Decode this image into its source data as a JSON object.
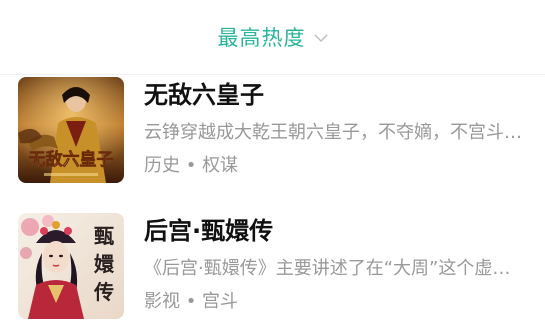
{
  "sort": {
    "label": "最高热度",
    "icon": "chevron-down-icon",
    "accent_color": "#2bb59a"
  },
  "books": [
    {
      "title": "无敌六皇子",
      "description": "云铮穿越成大乾王朝六皇子，不夺嫡，不宫斗…",
      "tags": "历史 • 权谋",
      "cover_text": "无敌六皇子"
    },
    {
      "title": "后宫·甄嬛传",
      "description": "《后宫·甄嬛传》主要讲述了在“大周”这个虚构的…",
      "tags": "影视 • 宫斗",
      "cover_text": "甄嬛传"
    }
  ]
}
